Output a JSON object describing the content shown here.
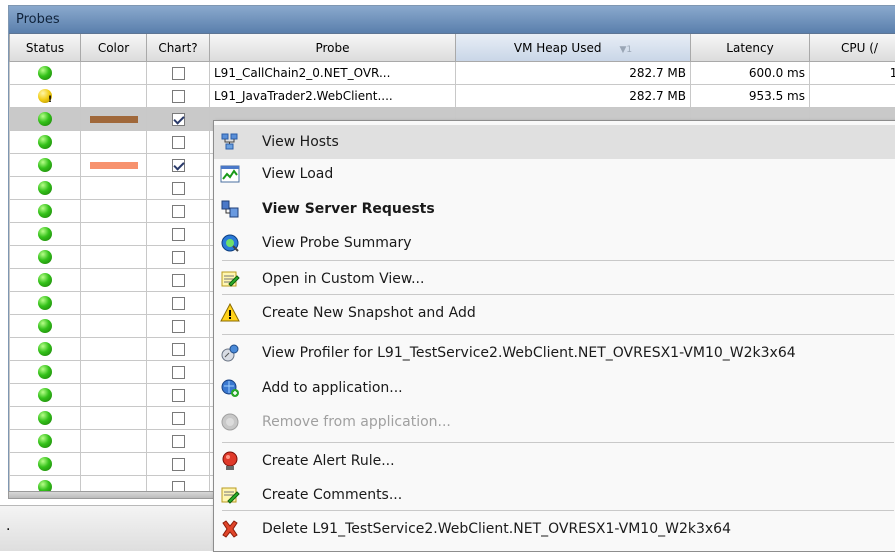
{
  "panel": {
    "title": "Probes"
  },
  "columns": {
    "status": "Status",
    "color": "Color",
    "chart": "Chart?",
    "probe": "Probe",
    "vm_heap": "VM Heap Used",
    "vm_heap_sort": "▼1",
    "latency": "Latency",
    "cpu": "CPU (/"
  },
  "rows": [
    {
      "status": "ok",
      "color": "",
      "chart": false,
      "probe": "L91_CallChain2_0.NET_OVR...",
      "vm_heap": "282.7 MB",
      "latency": "600.0 ms",
      "cpu": "10"
    },
    {
      "status": "warn",
      "color": "",
      "chart": false,
      "probe": "L91_JavaTrader2.WebClient....",
      "vm_heap": "282.7 MB",
      "latency": "953.5 ms",
      "cpu": ""
    },
    {
      "status": "ok",
      "color": "#a0683a",
      "chart": true,
      "probe": "",
      "vm_heap": "",
      "latency": "",
      "cpu": "",
      "selected": true
    },
    {
      "status": "ok",
      "color": "",
      "chart": false
    },
    {
      "status": "ok",
      "color": "#f7926e",
      "chart": true
    },
    {
      "status": "ok",
      "color": "",
      "chart": false
    },
    {
      "status": "ok",
      "color": "",
      "chart": false
    },
    {
      "status": "ok",
      "color": "",
      "chart": false
    },
    {
      "status": "ok",
      "color": "",
      "chart": false
    },
    {
      "status": "ok",
      "color": "",
      "chart": false
    },
    {
      "status": "ok",
      "color": "",
      "chart": false
    },
    {
      "status": "ok",
      "color": "",
      "chart": false
    },
    {
      "status": "ok",
      "color": "",
      "chart": false
    },
    {
      "status": "ok",
      "color": "",
      "chart": false
    },
    {
      "status": "ok",
      "color": "",
      "chart": false
    },
    {
      "status": "ok",
      "color": "",
      "chart": false
    },
    {
      "status": "ok",
      "color": "",
      "chart": false
    },
    {
      "status": "ok",
      "color": "",
      "chart": false
    },
    {
      "status": "ok",
      "color": "",
      "chart": false
    }
  ],
  "status_bar": {
    "text": "."
  },
  "menu": {
    "items": [
      {
        "label": "View Hosts",
        "icon": "hosts-icon",
        "hover": true
      },
      {
        "label": "View Load",
        "icon": "load-chart-icon"
      },
      {
        "label": "View Server Requests",
        "icon": "server-requests-icon",
        "bold": true
      },
      {
        "label": "View Probe Summary",
        "icon": "probe-summary-icon"
      },
      {
        "label": "Open in Custom View...",
        "icon": "custom-view-icon",
        "sep_before": true
      },
      {
        "label": "Create New Snapshot and Add",
        "icon": "warning-icon",
        "sep_before": true
      },
      {
        "label": "View Profiler for L91_TestService2.WebClient.NET_OVRESX1-VM10_W2k3x64",
        "icon": "profiler-icon",
        "sep_before": true
      },
      {
        "label": "Add to application...",
        "icon": "add-app-icon"
      },
      {
        "label": "Remove from application...",
        "icon": "remove-app-icon",
        "disabled": true
      },
      {
        "label": "Create Alert Rule...",
        "icon": "alert-rule-icon",
        "sep_before": true
      },
      {
        "label": "Create Comments...",
        "icon": "comments-icon"
      },
      {
        "label": "Delete L91_TestService2.WebClient.NET_OVRESX1-VM10_W2k3x64",
        "icon": "delete-icon",
        "sep_before": true
      }
    ]
  },
  "colors": {
    "header_blue": "#5a7fac",
    "status_green": "#34c21a",
    "status_yellow": "#f1cc12",
    "delete_red": "#d83a1e"
  }
}
